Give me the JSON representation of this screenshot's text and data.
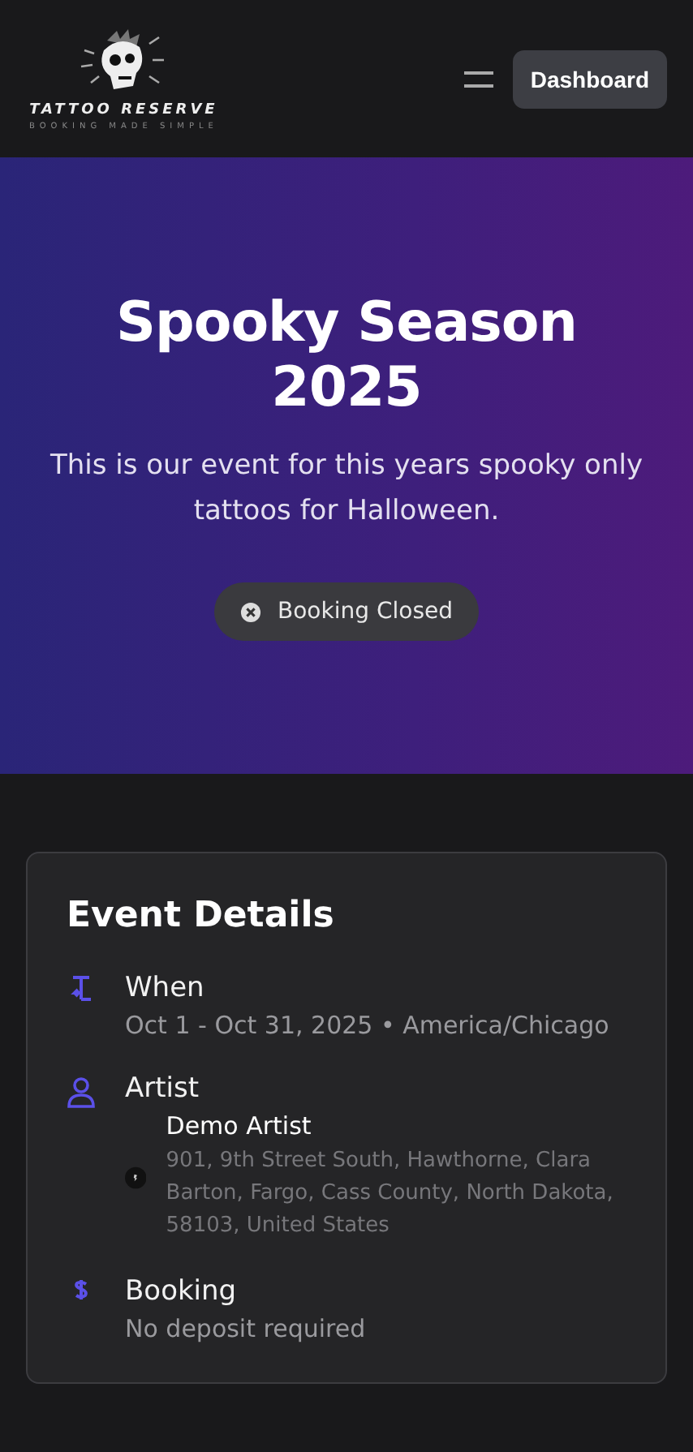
{
  "header": {
    "brand": "TATTOO RESERVE",
    "tagline": "BOOKING MADE SIMPLE",
    "button": "Dashboard"
  },
  "hero": {
    "title": "Spooky Season 2025",
    "description": "This is our event for this years spooky only tattoos for Halloween.",
    "status": {
      "label": "Booking Closed",
      "open": false
    }
  },
  "details": {
    "title": "Event Details",
    "sections": [
      {
        "kind": "when",
        "label": "When",
        "value": "Oct 1 - Oct 31, 2025 • America/Chicago"
      },
      {
        "kind": "artist",
        "label": "Artist",
        "name": "Demo Artist",
        "address": "901, 9th Street South, Hawthorne, Clara Barton, Fargo, Cass County, North Dakota, 58103, United States"
      },
      {
        "kind": "booking",
        "label": "Booking",
        "value": "No deposit required"
      }
    ]
  }
}
